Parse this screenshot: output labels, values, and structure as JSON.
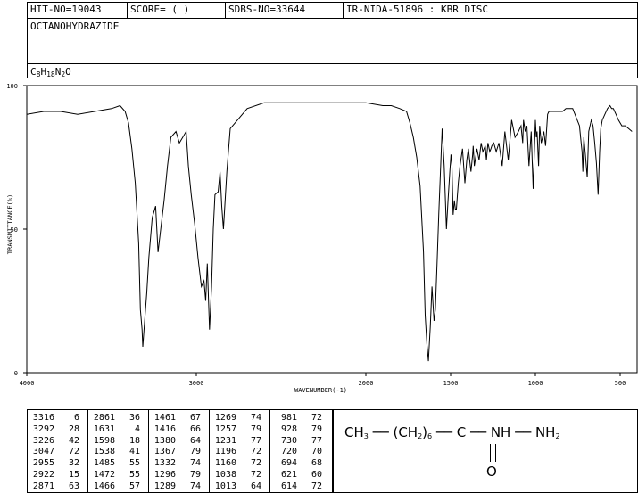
{
  "header": {
    "hit_no": "HIT-NO=19043",
    "score": "SCORE=  (  )",
    "sdbs_no": "SDBS-NO=33644",
    "ir_nida": "IR-NIDA-51896 : KBR DISC",
    "compound": "OCTANOHYDRAZIDE",
    "formula_parts": [
      "C",
      "8",
      "H",
      "18",
      "N",
      "2",
      "O"
    ]
  },
  "chart_data": {
    "type": "line",
    "xlabel": "WAVENUMBER(-1)",
    "ylabel": "TRANSMITTANCE(%)",
    "xlim": [
      4000,
      400
    ],
    "ylim": [
      0,
      100
    ],
    "x_ticks": [
      4000,
      3000,
      2000,
      1500,
      1000,
      500
    ],
    "y_ticks": [
      0,
      50,
      100
    ],
    "x": [
      4000,
      3900,
      3800,
      3700,
      3600,
      3500,
      3450,
      3420,
      3400,
      3380,
      3360,
      3340,
      3330,
      3320,
      3316,
      3305,
      3292,
      3280,
      3260,
      3240,
      3226,
      3210,
      3190,
      3170,
      3150,
      3120,
      3100,
      3080,
      3060,
      3047,
      3030,
      3010,
      2990,
      2970,
      2955,
      2945,
      2935,
      2922,
      2910,
      2900,
      2890,
      2871,
      2860,
      2850,
      2840,
      2820,
      2800,
      2700,
      2600,
      2500,
      2400,
      2300,
      2200,
      2100,
      2000,
      1900,
      1850,
      1800,
      1760,
      1740,
      1720,
      1700,
      1680,
      1660,
      1650,
      1640,
      1631,
      1620,
      1610,
      1598,
      1590,
      1580,
      1570,
      1560,
      1550,
      1538,
      1525,
      1515,
      1505,
      1498,
      1492,
      1485,
      1478,
      1472,
      1466,
      1461,
      1455,
      1445,
      1430,
      1416,
      1405,
      1395,
      1380,
      1370,
      1367,
      1360,
      1345,
      1332,
      1320,
      1310,
      1296,
      1289,
      1280,
      1269,
      1262,
      1257,
      1245,
      1231,
      1215,
      1196,
      1180,
      1160,
      1140,
      1120,
      1100,
      1085,
      1075,
      1070,
      1060,
      1050,
      1038,
      1025,
      1013,
      1000,
      995,
      990,
      981,
      975,
      965,
      950,
      940,
      928,
      920,
      900,
      880,
      860,
      840,
      820,
      800,
      780,
      760,
      740,
      730,
      725,
      720,
      714,
      705,
      694,
      685,
      670,
      660,
      650,
      640,
      630,
      621,
      614,
      605,
      590,
      575,
      560,
      550,
      540,
      525,
      510,
      490,
      470,
      450,
      430,
      410,
      400
    ],
    "y": [
      90,
      91,
      91,
      90,
      91,
      92,
      93,
      91,
      87,
      78,
      66,
      45,
      22,
      15,
      9,
      18,
      28,
      40,
      54,
      58,
      42,
      50,
      60,
      72,
      82,
      84,
      80,
      82,
      84,
      72,
      62,
      52,
      40,
      30,
      32,
      25,
      38,
      15,
      30,
      50,
      62,
      63,
      70,
      58,
      50,
      70,
      85,
      92,
      94,
      94,
      94,
      94,
      94,
      94,
      94,
      93,
      93,
      92,
      91,
      87,
      82,
      75,
      65,
      42,
      20,
      10,
      4,
      16,
      30,
      18,
      22,
      38,
      55,
      70,
      85,
      72,
      50,
      60,
      70,
      76,
      72,
      55,
      60,
      57,
      57,
      61,
      66,
      72,
      78,
      66,
      74,
      78,
      70,
      76,
      79,
      72,
      78,
      74,
      80,
      77,
      79,
      74,
      80,
      77,
      78,
      79,
      80,
      77,
      80,
      72,
      84,
      74,
      88,
      82,
      84,
      86,
      80,
      88,
      84,
      86,
      72,
      84,
      64,
      88,
      82,
      84,
      72,
      86,
      80,
      84,
      79,
      90,
      91,
      91,
      91,
      91,
      91,
      92,
      92,
      92,
      89,
      86,
      80,
      77,
      70,
      82,
      76,
      68,
      84,
      88,
      86,
      80,
      73,
      62,
      77,
      85,
      88,
      90,
      92,
      93,
      92,
      92,
      90,
      88,
      86,
      86,
      85,
      84
    ],
    "peak_table": [
      [
        3316,
        6
      ],
      [
        3292,
        28
      ],
      [
        3226,
        42
      ],
      [
        3047,
        72
      ],
      [
        2955,
        32
      ],
      [
        2922,
        15
      ],
      [
        2871,
        63
      ],
      [
        2861,
        36
      ],
      [
        1631,
        4
      ],
      [
        1598,
        18
      ],
      [
        1538,
        41
      ],
      [
        1485,
        55
      ],
      [
        1472,
        55
      ],
      [
        1466,
        57
      ],
      [
        1461,
        67
      ],
      [
        1416,
        66
      ],
      [
        1380,
        64
      ],
      [
        1367,
        79
      ],
      [
        1332,
        74
      ],
      [
        1296,
        79
      ],
      [
        1289,
        74
      ],
      [
        1269,
        74
      ],
      [
        1257,
        79
      ],
      [
        1231,
        77
      ],
      [
        1196,
        72
      ],
      [
        1160,
        72
      ],
      [
        1038,
        72
      ],
      [
        1013,
        64
      ],
      [
        981,
        72
      ],
      [
        928,
        79
      ],
      [
        730,
        77
      ],
      [
        720,
        70
      ],
      [
        694,
        68
      ],
      [
        621,
        60
      ],
      [
        614,
        72
      ]
    ]
  },
  "structure": {
    "ch3": "CH",
    "ch3_sub": "3",
    "chain": "(CH",
    "chain_sub1": "2",
    "chain_close": ")",
    "chain_sub2": "6",
    "carbon": "C",
    "nh": "NH",
    "nh2": "NH",
    "nh2_sub": "2",
    "oxygen": "O"
  }
}
